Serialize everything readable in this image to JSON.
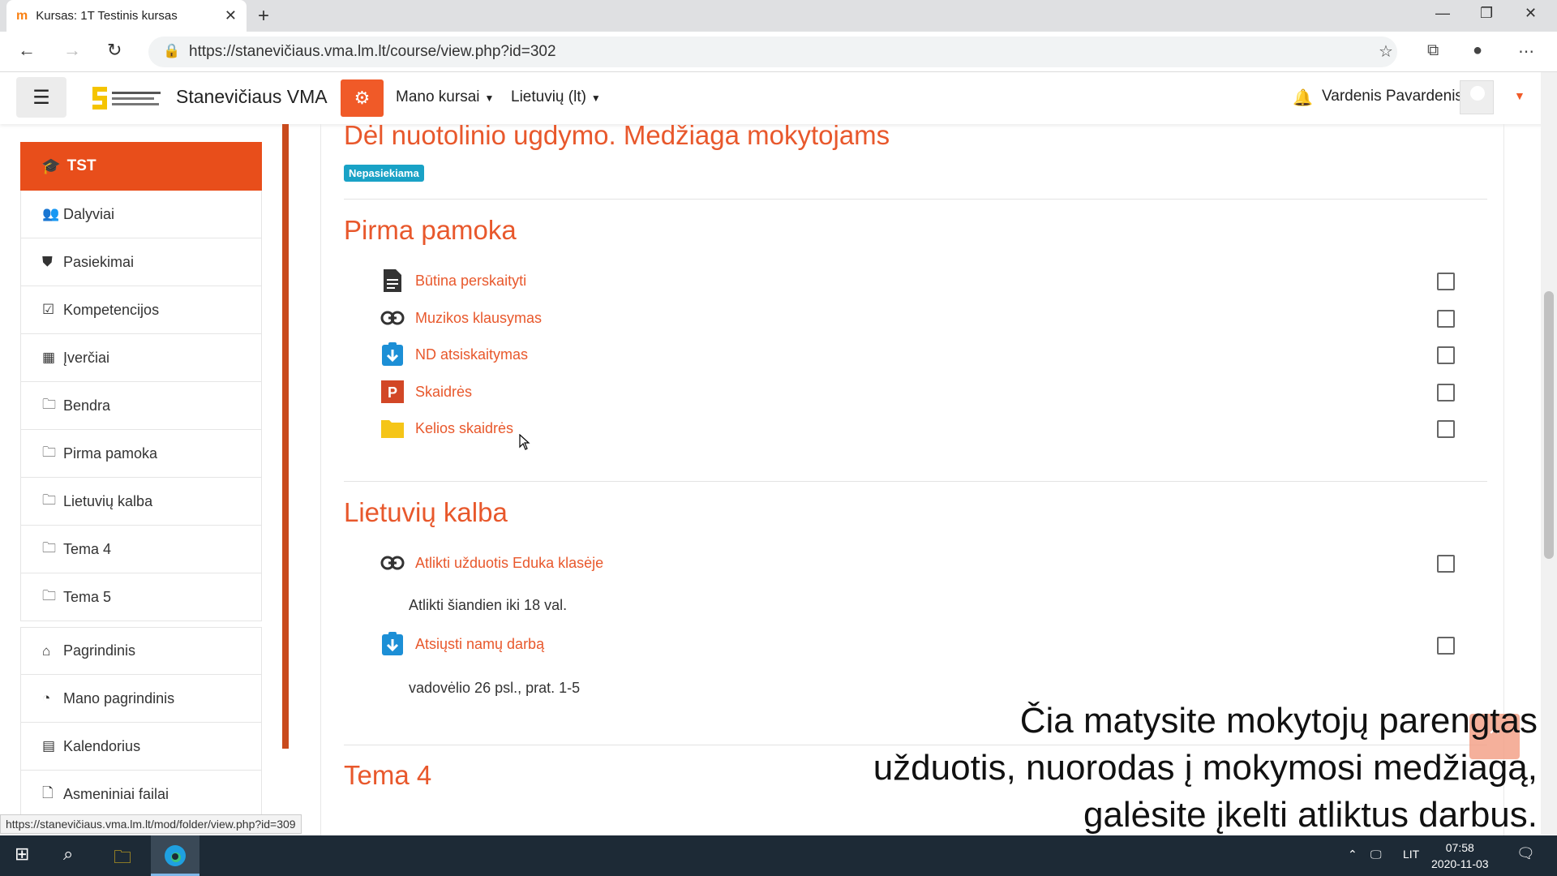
{
  "browser": {
    "tab_title": "Kursas: 1T Testinis kursas",
    "url": "https://stanevičiaus.vma.lm.lt/course/view.php?id=302",
    "status_url": "https://stanevičiaus.vma.lm.lt/mod/folder/view.php?id=309"
  },
  "navbar": {
    "site_name": "Stanevičiaus VMA",
    "my_courses": "Mano kursai",
    "language": "Lietuvių (lt)",
    "user_name": "Vardenis Pavardenis",
    "accent_color": "#f05a28"
  },
  "sidebar": {
    "course_short": "TST",
    "items": [
      {
        "label": "Dalyviai",
        "icon": "users-icon"
      },
      {
        "label": "Pasiekimai",
        "icon": "shield-icon"
      },
      {
        "label": "Kompetencijos",
        "icon": "check-square-icon"
      },
      {
        "label": "Įverčiai",
        "icon": "table-icon"
      },
      {
        "label": "Bendra",
        "icon": "folder-icon"
      },
      {
        "label": "Pirma pamoka",
        "icon": "folder-icon"
      },
      {
        "label": "Lietuvių kalba",
        "icon": "folder-icon"
      },
      {
        "label": "Tema 4",
        "icon": "folder-icon"
      },
      {
        "label": "Tema 5",
        "icon": "folder-icon"
      }
    ],
    "items2": [
      {
        "label": "Pagrindinis",
        "icon": "home-icon"
      },
      {
        "label": "Mano pagrindinis",
        "icon": "dashboard-icon"
      },
      {
        "label": "Kalendorius",
        "icon": "calendar-icon"
      },
      {
        "label": "Asmeniniai failai",
        "icon": "file-icon"
      }
    ]
  },
  "main": {
    "section0": {
      "title": "Dėl nuotolinio ugdymo. Medžiaga mokytojams",
      "badge": "Nepasiekiama"
    },
    "section1": {
      "title": "Pirma pamoka",
      "activities": [
        {
          "label": "Būtina perskaityti",
          "icon": "page-icon"
        },
        {
          "label": "Muzikos klausymas",
          "icon": "link-icon"
        },
        {
          "label": "ND atsiskaitymas",
          "icon": "assignment-icon"
        },
        {
          "label": "Skaidrės",
          "icon": "powerpoint-icon"
        },
        {
          "label": "Kelios skaidrės",
          "icon": "folder-icon"
        }
      ]
    },
    "section2": {
      "title": "Lietuvių kalba",
      "activities": [
        {
          "label": "Atlikti užduotis Eduka klasėje",
          "icon": "link-icon",
          "description": "Atlikti šiandien iki 18 val."
        },
        {
          "label": "Atsiųsti namų darbą",
          "icon": "assignment-icon",
          "description": "vadovėlio 26 psl., prat. 1-5"
        }
      ]
    },
    "section3": {
      "title": "Tema 4"
    }
  },
  "caption": {
    "line1": "Čia matysite mokytojų parengtas",
    "line2": "užduotis, nuorodas į mokymosi medžiagą,",
    "line3": "galėsite įkelti atliktus darbus."
  },
  "taskbar": {
    "lang": "LIT",
    "time": "07:58",
    "date": "2020-11-03"
  }
}
